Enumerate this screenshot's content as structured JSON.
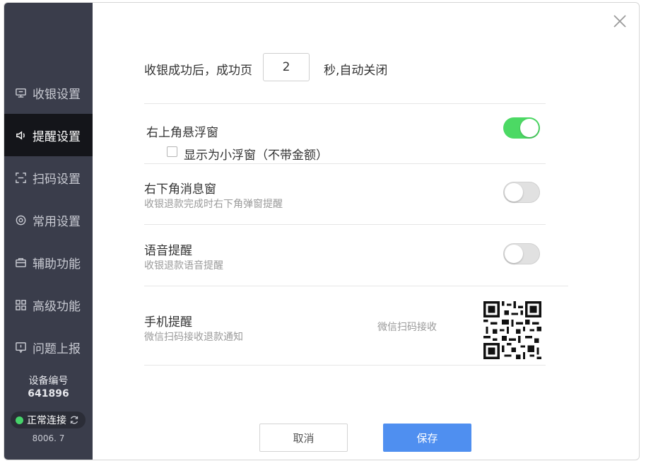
{
  "sidebar": {
    "items": [
      {
        "label": "收银设置",
        "icon": "cashier-icon",
        "active": false
      },
      {
        "label": "提醒设置",
        "icon": "speaker-icon",
        "active": true
      },
      {
        "label": "扫码设置",
        "icon": "scan-icon",
        "active": false
      },
      {
        "label": "常用设置",
        "icon": "gear-icon",
        "active": false
      },
      {
        "label": "辅助功能",
        "icon": "toolbox-icon",
        "active": false
      },
      {
        "label": "高级功能",
        "icon": "grid-icon",
        "active": false
      },
      {
        "label": "问题上报",
        "icon": "feedback-icon",
        "active": false
      }
    ],
    "device_label": "设备编号",
    "device_number": "641896",
    "connection_status": "正常连接",
    "version": "8006. 7"
  },
  "success_page": {
    "prefix": "收银成功后，成功页",
    "seconds": "2",
    "suffix": "秒,自动关闭"
  },
  "settings": {
    "top_right_float": {
      "title": "右上角悬浮窗",
      "enabled": true
    },
    "small_float_option": {
      "label": "显示为小浮窗（不带金额）",
      "checked": false
    },
    "bottom_right_msg": {
      "title": "右下角消息窗",
      "subtitle": "收银退款完成时右下角弹窗提醒",
      "enabled": false
    },
    "voice": {
      "title": "语音提醒",
      "subtitle": "收银退款语音提醒",
      "enabled": false
    },
    "mobile": {
      "title": "手机提醒",
      "subtitle": "微信扫码接收退款通知",
      "scan_hint": "微信扫码接收"
    }
  },
  "buttons": {
    "cancel": "取消",
    "save": "保存"
  },
  "colors": {
    "sidebar_bg": "#3a3d4b",
    "active_bg": "#14151a",
    "toggle_on": "#4cd964",
    "save_button": "#4f8ff0",
    "status_dot": "#46d36a"
  }
}
